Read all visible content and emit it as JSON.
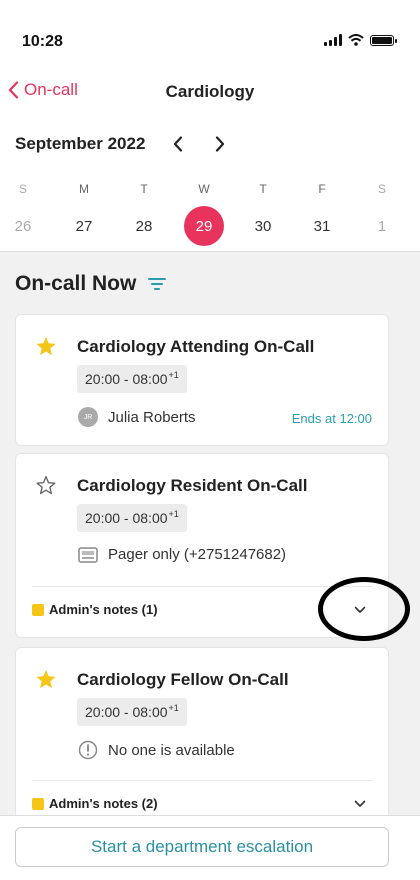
{
  "status_bar": {
    "time": "10:28"
  },
  "nav": {
    "back_label": "On-call",
    "title": "Cardiology"
  },
  "calendar": {
    "month": "September 2022",
    "weekdays": [
      "S",
      "M",
      "T",
      "W",
      "T",
      "F",
      "S"
    ],
    "dates": [
      "26",
      "27",
      "28",
      "29",
      "30",
      "31",
      "1"
    ],
    "selected_index": 3
  },
  "section": {
    "title": "On-call Now"
  },
  "cards": [
    {
      "title": "Cardiology Attending On-Call",
      "starred": true,
      "time": "20:00 - 08:00",
      "time_sup": "+1",
      "avatar_initials": "JR",
      "person": "Julia Roberts",
      "ends": "Ends at 12:00"
    },
    {
      "title": "Cardiology Resident On-Call",
      "starred": false,
      "time": "20:00 - 08:00",
      "time_sup": "+1",
      "info": "Pager only (+2751247682)",
      "notes": "Admin's notes (1)"
    },
    {
      "title": "Cardiology Fellow On-Call",
      "starred": true,
      "time": "20:00 - 08:00",
      "time_sup": "+1",
      "info": "No one is available",
      "notes": "Admin's notes (2)"
    }
  ],
  "footer": {
    "button_label": "Start a department escalation"
  },
  "colors": {
    "accent": "#e8345c",
    "teal": "#2a8f9f",
    "star": "#f5c518"
  },
  "icons": [
    "chevron-left-icon",
    "chevron-right-icon",
    "filter-icon",
    "star-filled-icon",
    "star-outline-icon",
    "pager-icon",
    "info-circle-icon",
    "note-icon",
    "chevron-down-icon"
  ]
}
